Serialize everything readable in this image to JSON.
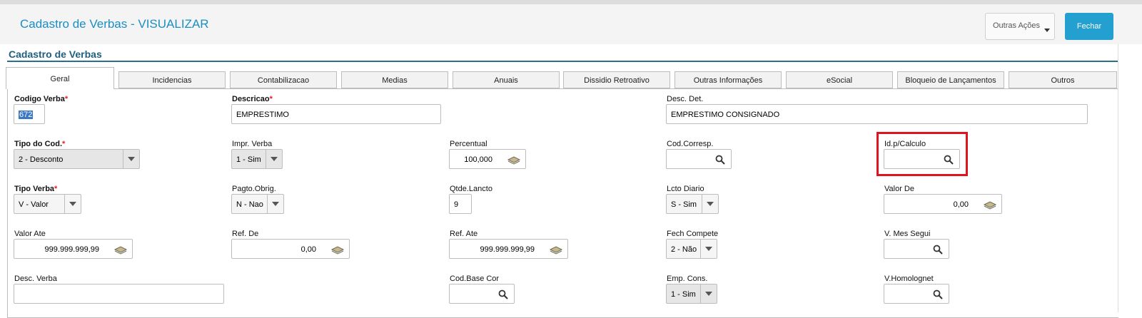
{
  "header": {
    "title": "Cadastro de Verbas - VISUALIZAR",
    "outras_acoes": "Outras Ações",
    "fechar": "Fechar"
  },
  "section_title": "Cadastro de Verbas",
  "tabs": [
    "Geral",
    "Incidencias",
    "Contabilizacao",
    "Medias",
    "Anuais",
    "Dissidio Retroativo",
    "Outras Informações",
    "eSocial",
    "Bloqueio de Lançamentos",
    "Outros"
  ],
  "fields": {
    "codigo_verba": {
      "label": "Codigo Verba",
      "value": "672"
    },
    "descricao": {
      "label": "Descricao",
      "value": "EMPRESTIMO"
    },
    "desc_det": {
      "label": "Desc. Det.",
      "value": "EMPRESTIMO CONSIGNADO"
    },
    "tipo_cod": {
      "label": "Tipo do Cod.",
      "value": "2 - Desconto"
    },
    "impr_verba": {
      "label": "Impr. Verba",
      "value": "1 - Sim"
    },
    "percentual": {
      "label": "Percentual",
      "value": "100,000"
    },
    "cod_corresp": {
      "label": "Cod.Corresp.",
      "value": ""
    },
    "id_calculo": {
      "label": "Id.p/Calculo",
      "value": ""
    },
    "tipo_verba": {
      "label": "Tipo Verba",
      "value": "V - Valor"
    },
    "pagto_obrig": {
      "label": "Pagto.Obrig.",
      "value": "N - Nao"
    },
    "qtde_lancto": {
      "label": "Qtde.Lancto",
      "value": "9"
    },
    "lcto_diario": {
      "label": "Lcto Diario",
      "value": "S - Sim"
    },
    "valor_de": {
      "label": "Valor De",
      "value": "0,00"
    },
    "valor_ate": {
      "label": "Valor Ate",
      "value": "999.999.999,99"
    },
    "ref_de": {
      "label": "Ref. De",
      "value": "0,00"
    },
    "ref_ate": {
      "label": "Ref. Ate",
      "value": "999.999.999,99"
    },
    "fech_compete": {
      "label": "Fech Compete",
      "value": "2 - Não"
    },
    "v_mes_segui": {
      "label": "V. Mes Segui",
      "value": ""
    },
    "desc_verba": {
      "label": "Desc. Verba",
      "value": ""
    },
    "cod_base_cor": {
      "label": "Cod.Base Cor",
      "value": ""
    },
    "emp_cons": {
      "label": "Emp. Cons.",
      "value": "1 - Sim"
    },
    "v_homolognet": {
      "label": "V.Homolognet",
      "value": ""
    }
  },
  "required_mark": "*",
  "colors": {
    "title": "#1a8ec4",
    "primary_button": "#23a0cf",
    "section_title": "#1f5f7f",
    "highlight": "#e0141e",
    "required": "#e02020"
  },
  "icons": [
    "search-icon",
    "money-icon",
    "chevron-down-icon"
  ]
}
